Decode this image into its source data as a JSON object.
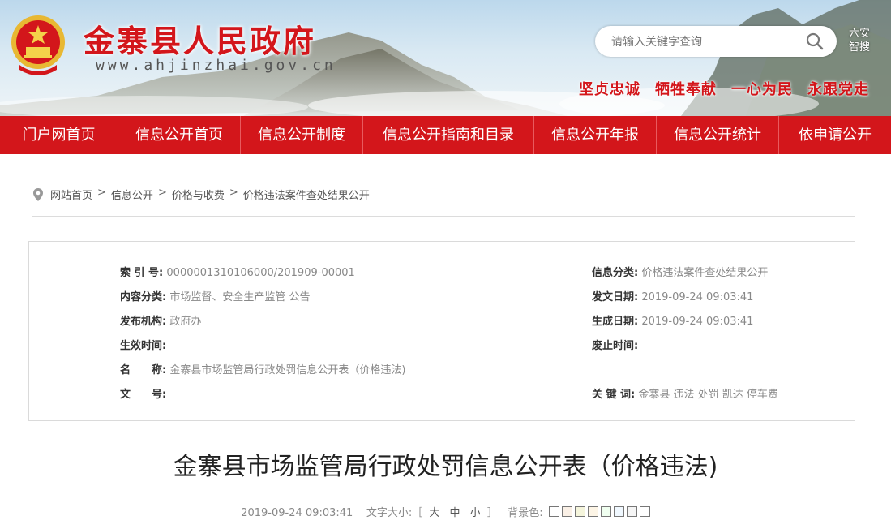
{
  "header": {
    "site_title": "金寨县人民政府",
    "site_domain": "www.ahjinzhai.gov.cn",
    "search_placeholder": "请输入关键字查询",
    "smart_search_line1": "六安",
    "smart_search_line2": "智搜",
    "slogans": [
      "坚贞忠诚",
      "牺牲奉献",
      "一心为民",
      "永跟党走"
    ]
  },
  "nav": {
    "items": [
      "门户网首页",
      "信息公开首页",
      "信息公开制度",
      "信息公开指南和目录",
      "信息公开年报",
      "信息公开统计",
      "依申请公开"
    ]
  },
  "breadcrumb": {
    "items": [
      "网站首页",
      "信息公开",
      "价格与收费",
      "价格违法案件查处结果公开"
    ],
    "separator": ">"
  },
  "meta": {
    "index_label": "索 引 号:",
    "index_value": "0000001310106000/201909-00001",
    "category_label": "内容分类:",
    "category_value": "市场监督、安全生产监管  公告",
    "org_label": "发布机构:",
    "org_value": "政府办",
    "effective_label": "生效时间:",
    "effective_value": "",
    "name_label": "名　　称:",
    "name_value": "金寨县市场监管局行政处罚信息公开表（价格违法)",
    "docno_label": "文　　号:",
    "docno_value": "",
    "info_class_label": "信息分类:",
    "info_class_value": "价格违法案件查处结果公开",
    "issue_date_label": "发文日期:",
    "issue_date_value": "2019-09-24 09:03:41",
    "gen_date_label": "生成日期:",
    "gen_date_value": "2019-09-24 09:03:41",
    "expire_label": "废止时间:",
    "expire_value": "",
    "keywords_label": "关 键 词:",
    "keywords_value": "金寨县  违法  处罚  凯达  停车费"
  },
  "article": {
    "title": "金寨县市场监管局行政处罚信息公开表（价格违法)",
    "date": "2019-09-24 09:03:41",
    "font_size_label": "文字大小:［",
    "font_size_options": [
      "大",
      "中",
      "小"
    ],
    "font_size_close": "］",
    "bg_color_label": "背景色:",
    "bg_colors": [
      "#ffffff",
      "#faf0e6",
      "#f5f5dc",
      "#fdf5e6",
      "#f0fff0",
      "#f0f8ff",
      "#f5f5f5",
      "#ffffff"
    ]
  },
  "colors": {
    "brand_red": "#d3161b"
  }
}
